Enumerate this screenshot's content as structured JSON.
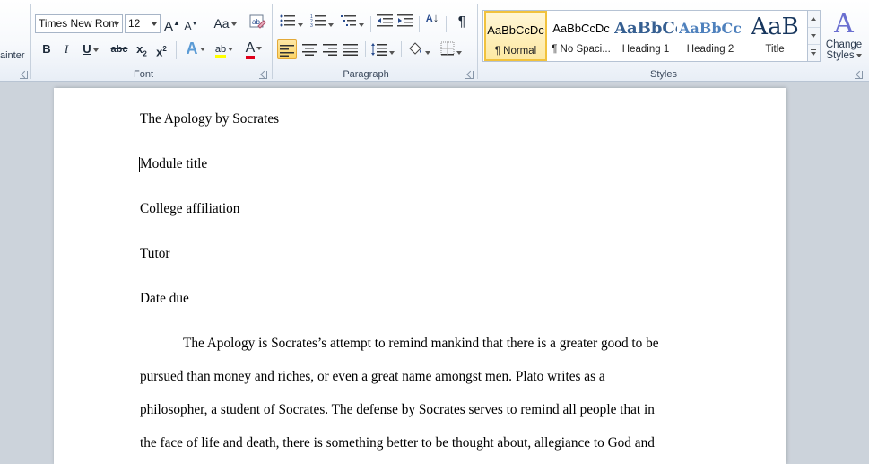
{
  "ribbon": {
    "clipboard": {
      "format_painter_fragment": "ainter"
    },
    "font": {
      "label": "Font",
      "font_name": "Times New Rom",
      "font_size": "12",
      "grow": "A",
      "shrink": "A",
      "change_case": "Aa",
      "bold": "B",
      "italic": "I",
      "underline": "U",
      "strikethrough": "abc",
      "subscript": "x",
      "superscript": "x",
      "text_effects": "A",
      "highlight": "ab",
      "font_color": "A",
      "highlight_color": "#ffff00",
      "font_color_value": "#e0001b"
    },
    "paragraph": {
      "label": "Paragraph",
      "sort": "A",
      "show_marks": "¶",
      "active_alignment": "align-left"
    },
    "styles": {
      "label": "Styles",
      "items": [
        {
          "sample": "AaBbCcDc",
          "name": "¶ Normal",
          "active": true
        },
        {
          "sample": "AaBbCcDc",
          "name": "¶ No Spaci...",
          "active": false
        },
        {
          "sample": "AaBbCc",
          "name": "Heading 1",
          "active": false
        },
        {
          "sample": "AaBbCc",
          "name": "Heading 2",
          "active": false
        },
        {
          "sample": "AaB",
          "name": "Title",
          "active": false
        }
      ],
      "change_styles_line1": "Change",
      "change_styles_line2": "Styles",
      "heading_color": "#365f91",
      "title_color": "#17365d"
    }
  },
  "document": {
    "lines": [
      "The Apology by Socrates",
      "Module title",
      "College affiliation",
      "Tutor",
      "Date due",
      "The Apology is Socrates’s attempt to remind mankind that there is a greater good to be",
      "pursued than money and riches, or even a great name amongst men. Plato writes as a",
      "philosopher, a student of Socrates. The defense by Socrates serves to remind all people that in",
      "the face of life and death, there is something better to be thought about, allegiance to God and"
    ]
  }
}
